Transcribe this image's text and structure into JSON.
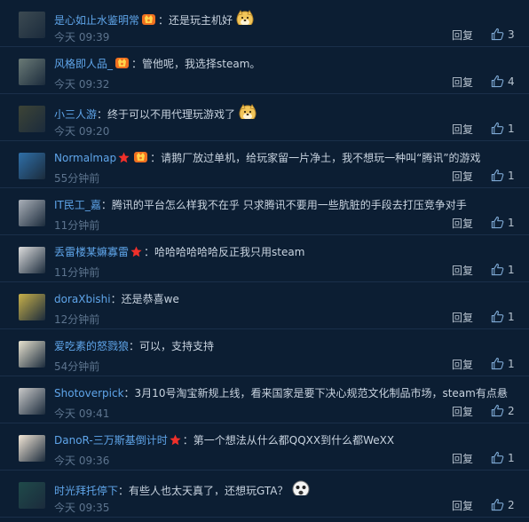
{
  "comments": [
    {
      "user": "是心如止水鉴明常",
      "badges": [
        "vip"
      ],
      "sep": "：",
      "text": "还是玩主机好",
      "emoji": "doge",
      "time": "今天 09:39",
      "reply": "回复",
      "likes": "3",
      "avatar": "#3c4a52"
    },
    {
      "user": "风格即人品_",
      "badges": [
        "vip"
      ],
      "sep": "：",
      "text": "管他呢，我选择steam。",
      "emoji": "",
      "time": "今天 09:32",
      "reply": "回复",
      "likes": "4",
      "avatar": "#6a7a76"
    },
    {
      "user": "小三人游",
      "badges": [],
      "sep": "：",
      "text": "终于可以不用代理玩游戏了",
      "emoji": "doge",
      "time": "今天 09:20",
      "reply": "回复",
      "likes": "1",
      "avatar": "#3d4436"
    },
    {
      "user": "Normalmap",
      "badges": [
        "star",
        "vip"
      ],
      "sep": "：",
      "text": "请鹅厂放过单机，给玩家留一片净土，我不想玩一种叫“腾讯”的游戏",
      "emoji": "",
      "time": "55分钟前",
      "reply": "回复",
      "likes": "1",
      "avatar": "#2f6fa8"
    },
    {
      "user": "IT民工_嘉",
      "badges": [],
      "sep": "：",
      "text": "腾讯的平台怎么样我不在乎 只求腾讯不要用一些肮脏的手段去打压竞争对手",
      "emoji": "",
      "time": "11分钟前",
      "reply": "回复",
      "likes": "1",
      "avatar": "#aab0b8"
    },
    {
      "user": "丢雷楼某嫲寡雷",
      "badges": [
        "star"
      ],
      "sep": "：",
      "text": "哈哈哈哈哈哈反正我只用steam",
      "emoji": "",
      "time": "11分钟前",
      "reply": "回复",
      "likes": "1",
      "avatar": "#dcdcdc"
    },
    {
      "user": "doraXbishi",
      "badges": [],
      "sep": "：",
      "text": "还是恭喜we",
      "emoji": "",
      "time": "12分钟前",
      "reply": "回复",
      "likes": "1",
      "avatar": "#c7b04a"
    },
    {
      "user": "爱吃素的怒戮狼",
      "badges": [],
      "sep": "：",
      "text": "可以，支持支持",
      "emoji": "",
      "time": "54分钟前",
      "reply": "回复",
      "likes": "1",
      "avatar": "#e7e2cf"
    },
    {
      "user": "Shotoverpick",
      "badges": [],
      "sep": "：",
      "text": "3月10号淘宝新规上线，看来国家是要下决心规范文化制品市场，steam有点悬",
      "emoji": "",
      "time": "今天 09:41",
      "reply": "回复",
      "likes": "2",
      "avatar": "#c9c9c9"
    },
    {
      "user": "DanoR-三万斯基倒计时",
      "badges": [
        "star"
      ],
      "sep": "：",
      "text": "第一个想法从什么都QQXX到什么都WeXX",
      "emoji": "",
      "time": "今天 09:36",
      "reply": "回复",
      "likes": "1",
      "avatar": "#f2e6d6"
    },
    {
      "user": "时光拜托停下",
      "badges": [],
      "sep": "：",
      "text": "有些人也太天真了，还想玩GTA？",
      "emoji": "shock",
      "time": "今天 09:35",
      "reply": "回复",
      "likes": "2",
      "avatar": "#1f4a4a"
    }
  ]
}
